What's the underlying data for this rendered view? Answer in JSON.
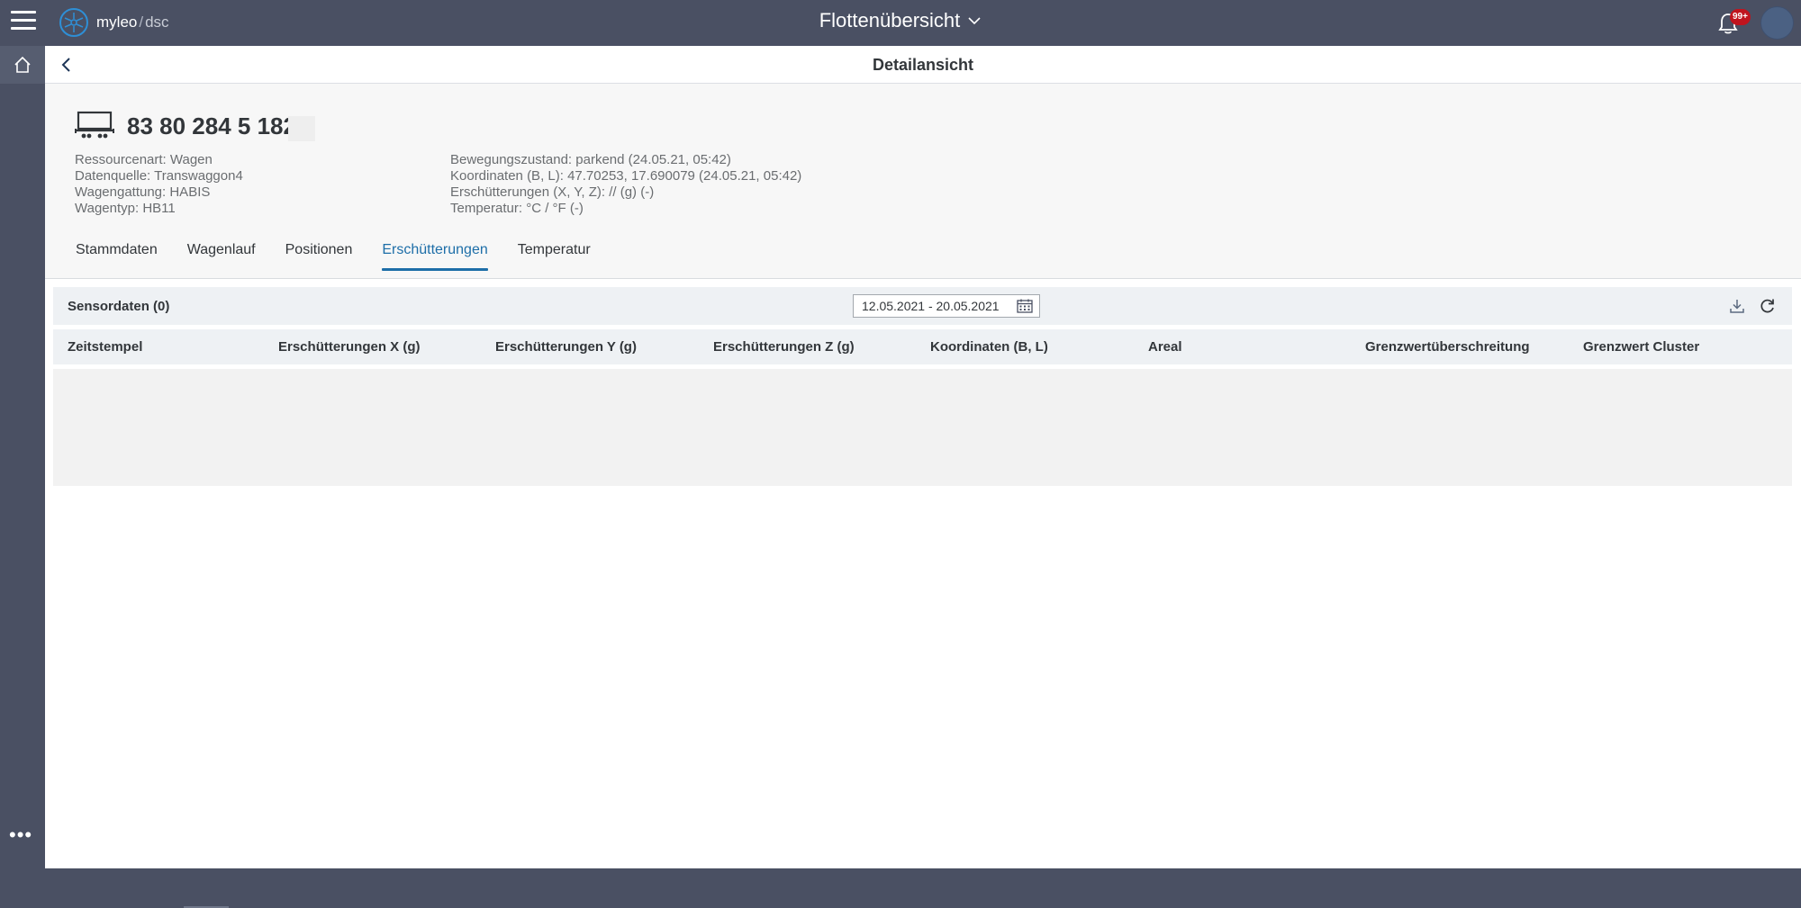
{
  "topbar": {
    "logo_name": "myleo",
    "logo_sep": "/",
    "logo_suffix": "dsc",
    "title": "Flottenübersicht",
    "notification_badge": "99+"
  },
  "subheader": {
    "title": "Detailansicht"
  },
  "object": {
    "title": "83 80 284 5 182",
    "attributes_left": [
      "Ressourcenart: Wagen",
      "Datenquelle: Transwaggon4",
      "Wagengattung: HABIS",
      "Wagentyp: HB11"
    ],
    "attributes_right": [
      "Bewegungszustand: parkend (24.05.21, 05:42)",
      "Koordinaten (B, L): 47.70253, 17.690079 (24.05.21, 05:42)",
      "Erschütterungen (X, Y, Z): // (g) (-)",
      "Temperatur: °C / °F (-)"
    ]
  },
  "tabs": [
    {
      "label": "Stammdaten",
      "active": false
    },
    {
      "label": "Wagenlauf",
      "active": false
    },
    {
      "label": "Positionen",
      "active": false
    },
    {
      "label": "Erschütterungen",
      "active": true
    },
    {
      "label": "Temperatur",
      "active": false
    }
  ],
  "sensor": {
    "title": "Sensordaten (0)",
    "date_range": "12.05.2021 - 20.05.2021",
    "columns": [
      "Zeitstempel",
      "Erschütterungen X (g)",
      "Erschütterungen Y (g)",
      "Erschütterungen Z (g)",
      "Koordinaten (B, L)",
      "Areal",
      "Grenzwertüberschreitung",
      "Grenzwert Cluster"
    ]
  },
  "colors": {
    "shell": "#4a5063",
    "accent": "#1d6ea8",
    "badge": "#c0141e",
    "header_bg": "#f7f7f7",
    "toolbar_bg": "#eef1f4"
  },
  "icons": [
    "menu-icon",
    "myleo-logo-icon",
    "chevron-down-icon",
    "bell-icon",
    "home-icon",
    "back-icon",
    "wagon-icon",
    "calendar-icon",
    "download-icon",
    "refresh-icon",
    "more-icon"
  ]
}
